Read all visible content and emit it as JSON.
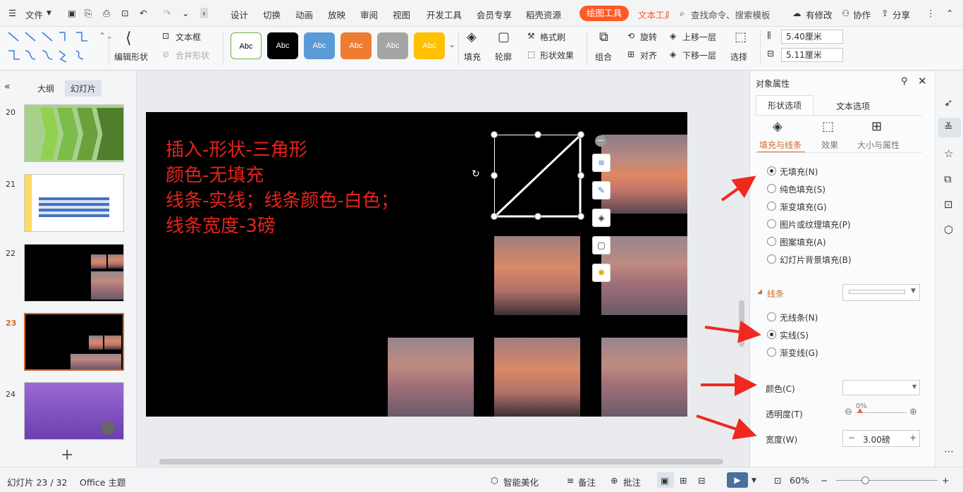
{
  "menubar": {
    "file": "文件",
    "tabs": [
      "设计",
      "切换",
      "动画",
      "放映",
      "审阅",
      "视图",
      "开发工具",
      "会员专享",
      "稻壳资源"
    ],
    "active_tool": "绘图工具",
    "text_tool": "文本工具",
    "search": "查找命令、搜索模板",
    "changes": "有修改",
    "collab": "协作",
    "share": "分享"
  },
  "ribbon": {
    "edit_shape": "编辑形状",
    "textbox": "文本框",
    "merge_shape": "合并形状",
    "style_label": "Abc",
    "fill": "填充",
    "outline": "轮廓",
    "format_brush": "格式刷",
    "shape_effect": "形状效果",
    "group": "组合",
    "rotate": "旋转",
    "align": "对齐",
    "move_up": "上移一层",
    "move_down": "下移一层",
    "select": "选择",
    "height": "5.40厘米",
    "width": "5.11厘米"
  },
  "left_panel": {
    "tab_outline": "大纲",
    "tab_slides": "幻灯片",
    "slides": [
      {
        "num": "20"
      },
      {
        "num": "21"
      },
      {
        "num": "22"
      },
      {
        "num": "23"
      },
      {
        "num": "24"
      }
    ],
    "add": "+"
  },
  "slide": {
    "lines": [
      "插入-形状-三角形",
      "颜色-无填充",
      "线条-实线；线条颜色-白色；",
      "线条宽度-3磅"
    ],
    "text_color": "#e8231a"
  },
  "right_panel": {
    "title": "对象属性",
    "tab_shape": "形状选项",
    "tab_text": "文本选项",
    "sub_fill": "填充与线条",
    "sub_effect": "效果",
    "sub_size": "大小与属性",
    "fill_options": [
      "无填充(N)",
      "纯色填充(S)",
      "渐变填充(G)",
      "图片或纹理填充(P)",
      "图案填充(A)",
      "幻灯片背景填充(B)"
    ],
    "line_section": "线条",
    "line_options": [
      "无线条(N)",
      "实线(S)",
      "渐变线(G)"
    ],
    "color_label": "颜色(C)",
    "transparency_label": "透明度(T)",
    "transparency_value": "0%",
    "width_label": "宽度(W)",
    "width_value": "3.00磅"
  },
  "status": {
    "slide_pos": "幻灯片 23 / 32",
    "theme": "Office 主题",
    "beautify": "智能美化",
    "notes": "备注",
    "comments": "批注",
    "zoom": "60%"
  },
  "colors": {
    "accent": "#ff5a26",
    "arrow": "#f0281e"
  }
}
